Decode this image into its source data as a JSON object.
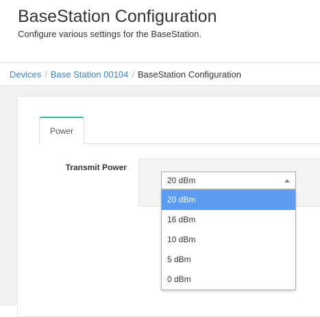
{
  "header": {
    "title": "BaseStation Configuration",
    "subtitle": "Configure various settings for the BaseStation."
  },
  "breadcrumb": {
    "items": [
      {
        "label": "Devices",
        "link": true
      },
      {
        "label": "Base Station 00104",
        "link": true
      },
      {
        "label": "BaseStation Configuration",
        "link": false
      }
    ],
    "separator": "/"
  },
  "tabs": [
    {
      "label": "Power",
      "active": true
    }
  ],
  "power": {
    "transmit_power_label": "Transmit Power",
    "selected_value": "20 dBm",
    "options": [
      "20 dBm",
      "16 dBm",
      "10 dBm",
      "5 dBm",
      "0 dBm"
    ],
    "highlighted_option": "20 dBm"
  },
  "colors": {
    "link": "#3b82c4",
    "tab_accent": "#3ab88b",
    "option_highlight": "#5b9cf0"
  }
}
